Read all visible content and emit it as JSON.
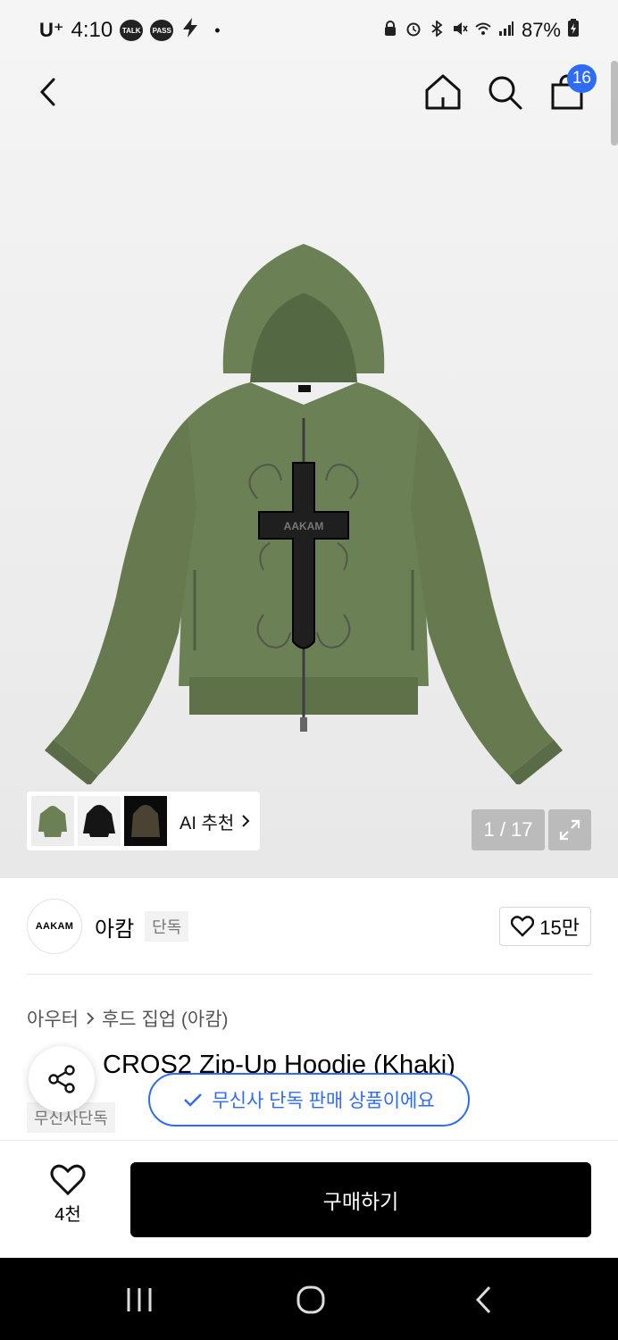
{
  "status_bar": {
    "carrier": "U⁺",
    "time": "4:10",
    "app_icons": [
      "TALK",
      "PASS"
    ],
    "battery": "87%"
  },
  "header": {
    "cart_count": "16"
  },
  "gallery": {
    "counter": "1 / 17",
    "ai_label": "AI 추천",
    "garment_print": "AAKAM"
  },
  "brand": {
    "logo_text": "AAKAM",
    "name": "아캄",
    "badge": "단독",
    "likes": "15만"
  },
  "breadcrumb": {
    "category": "아우터",
    "subcategory": "후드 집업 (아캄)"
  },
  "product": {
    "title": "CROS2 Zip-Up Hoodie (Khaki)",
    "exclusive_tag": "무신사단독"
  },
  "toast": {
    "text": "무신사 단독 판매 상품이에요"
  },
  "bottom": {
    "wish_count": "4천",
    "buy_label": "구매하기"
  },
  "colors": {
    "accent": "#2f6cf6",
    "hoodie": "#6b8055",
    "buy_button": "#000000"
  }
}
